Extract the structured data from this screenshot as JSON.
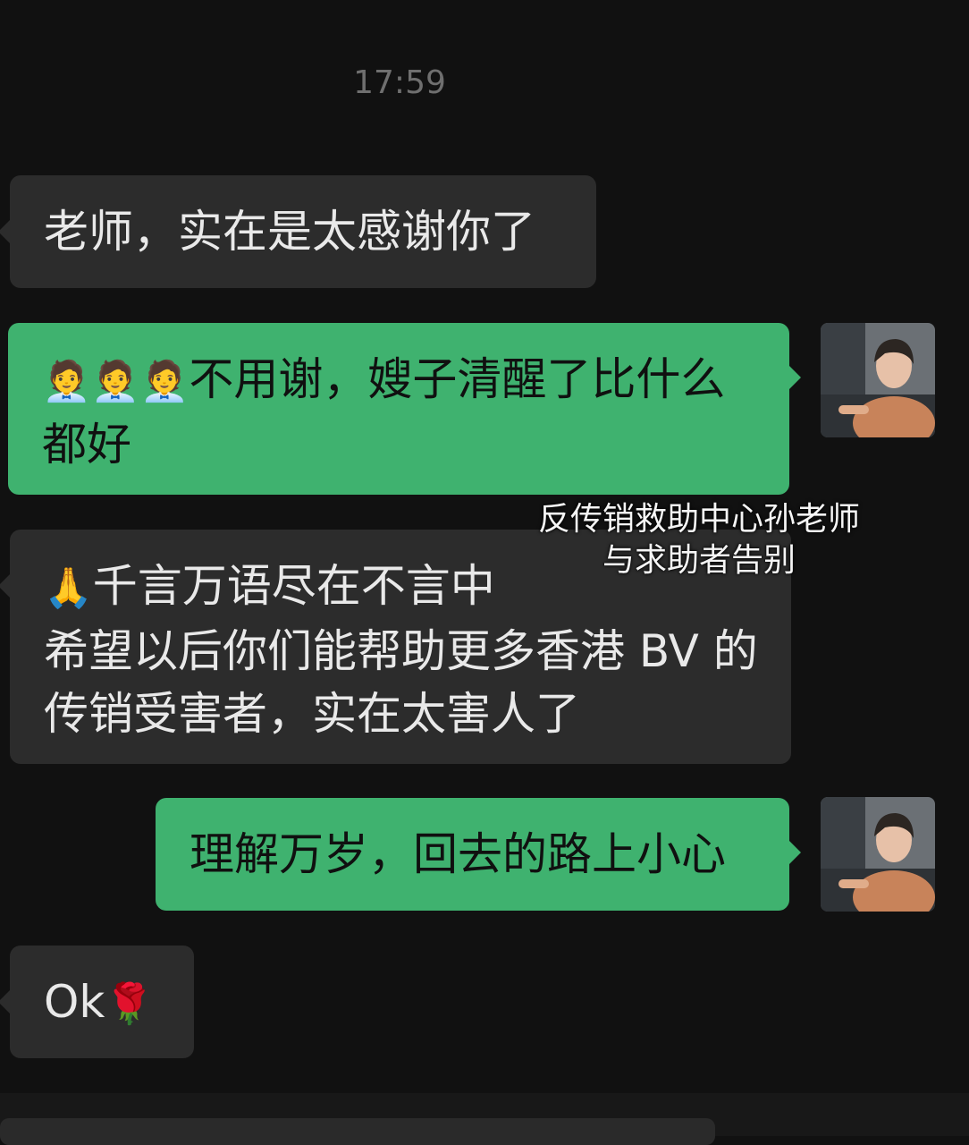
{
  "timestamp": "17:59",
  "messages": [
    {
      "side": "in",
      "lines": [
        "老师，实在是太感谢你了"
      ]
    },
    {
      "side": "out",
      "emoji": "🧑‍💼🧑‍💼🧑‍💼",
      "lines": [
        "不用谢，嫂子清醒了比什么",
        "都好"
      ]
    },
    {
      "side": "in",
      "emoji": "🙏",
      "lines": [
        "千言万语尽在不言中",
        "希望以后你们能帮助更多香港 BV 的",
        "传销受害者，实在太害人了"
      ]
    },
    {
      "side": "out",
      "lines": [
        "理解万岁，回去的路上小心"
      ]
    },
    {
      "side": "in",
      "lines": [
        "Ok"
      ],
      "emoji_after": "🌹"
    }
  ],
  "overlay_caption": {
    "line1": "反传销救助中心孙老师",
    "line2": "与求助者告别"
  },
  "colors": {
    "background": "#111111",
    "incoming_bubble": "#2c2c2c",
    "outgoing_bubble": "#3fb26f"
  }
}
